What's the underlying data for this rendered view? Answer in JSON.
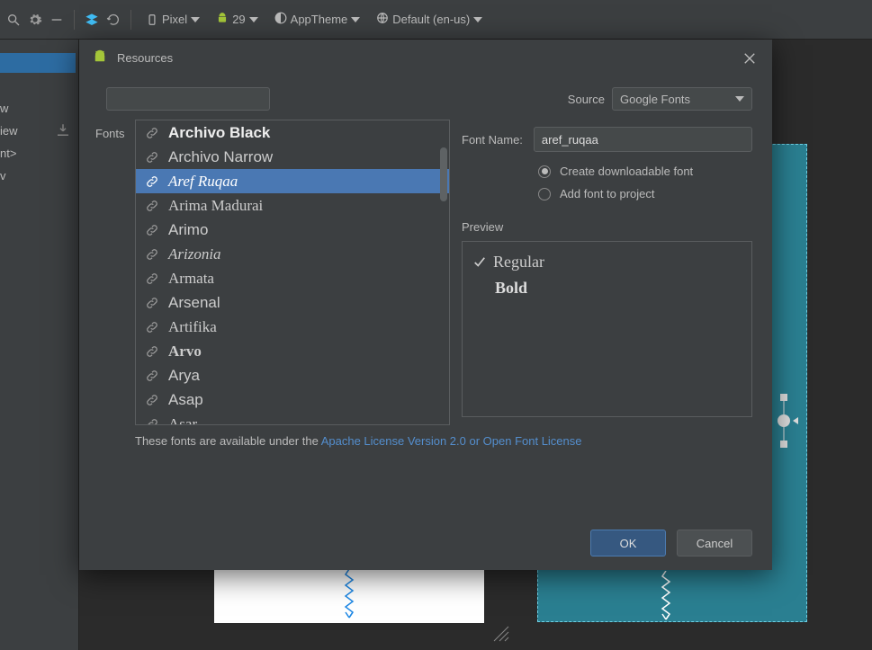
{
  "toolbar": {
    "pixel_label": "Pixel",
    "api_label": "29",
    "theme_label": "AppTheme",
    "locale_label": "Default (en-us)"
  },
  "left_panel": {
    "items": [
      "w",
      "iew",
      "nt>",
      "v"
    ]
  },
  "dialog": {
    "title": "Resources",
    "source_label": "Source",
    "source_value": "Google Fonts",
    "fonts_label": "Fonts",
    "font_name_label": "Font Name:",
    "font_name_value": "aref_ruqaa",
    "radio_download": "Create downloadable font",
    "radio_add": "Add font to project",
    "preview_label": "Preview",
    "preview_regular": "Regular",
    "preview_bold": "Bold",
    "license_pre": "These fonts are available under the ",
    "license_link": "Apache License Version 2.0 or Open Font License",
    "ok_label": "OK",
    "cancel_label": "Cancel"
  },
  "font_list": [
    {
      "name": "Archivo Black",
      "cls": "f-archivo-black"
    },
    {
      "name": "Archivo Narrow",
      "cls": "f-archivo-narrow"
    },
    {
      "name": "Aref Ruqaa",
      "cls": "f-aref",
      "selected": true
    },
    {
      "name": "Arima Madurai",
      "cls": "f-arima"
    },
    {
      "name": "Arimo",
      "cls": "f-arimo"
    },
    {
      "name": "Arizonia",
      "cls": "f-arizonia"
    },
    {
      "name": "Armata",
      "cls": "f-armata"
    },
    {
      "name": "Arsenal",
      "cls": "f-arsenal"
    },
    {
      "name": "Artifika",
      "cls": "f-artifika"
    },
    {
      "name": "Arvo",
      "cls": "f-arvo"
    },
    {
      "name": "Arya",
      "cls": "f-arya"
    },
    {
      "name": "Asap",
      "cls": "f-asap"
    },
    {
      "name": "Asar",
      "cls": "f-asar"
    }
  ]
}
